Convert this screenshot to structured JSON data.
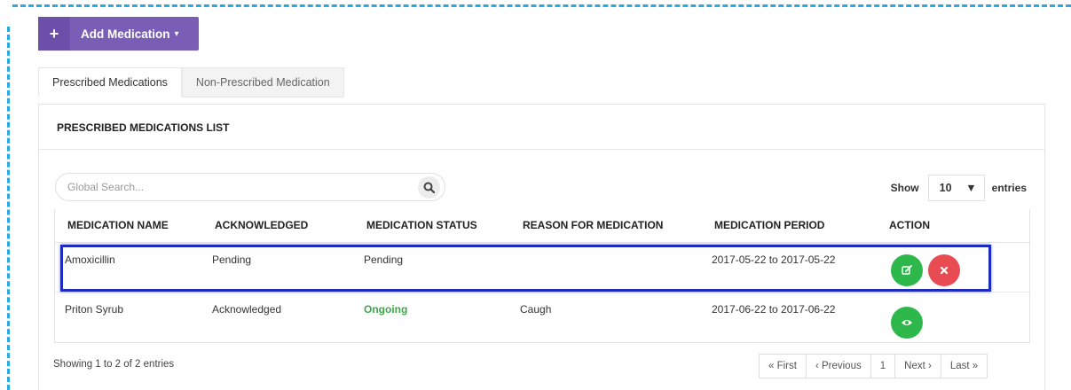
{
  "toolbar": {
    "add_label": "Add Medication",
    "plus_glyph": "+",
    "caret_glyph": "▾"
  },
  "tabs": [
    {
      "label": "Prescribed Medications",
      "active": true
    },
    {
      "label": "Non-Prescribed Medication",
      "active": false
    }
  ],
  "panel": {
    "title": "PRESCRIBED MEDICATIONS LIST"
  },
  "search": {
    "placeholder": "Global Search..."
  },
  "length": {
    "show_label": "Show",
    "value": "10",
    "entries_label": "entries"
  },
  "table": {
    "headers": [
      "MEDICATION NAME",
      "ACKNOWLEDGED",
      "MEDICATION STATUS",
      "REASON FOR MEDICATION",
      "MEDICATION PERIOD",
      "ACTION"
    ],
    "rows": [
      {
        "name": "Amoxicillin",
        "acknowledged": "Pending",
        "status": "Pending",
        "reason": "",
        "period": "2017-05-22 to 2017-05-22",
        "actions": [
          "edit-icon",
          "delete-icon"
        ]
      },
      {
        "name": "Priton Syrub",
        "acknowledged": "Acknowledged",
        "status": "Ongoing",
        "reason": "Caugh",
        "period": "2017-06-22 to 2017-06-22",
        "actions": [
          "view-icon"
        ]
      }
    ]
  },
  "footer": {
    "info": "Showing 1 to 2 of 2 entries",
    "pager": {
      "first": "« First",
      "previous": "‹ Previous",
      "page": "1",
      "next": "Next ›",
      "last": "Last »"
    }
  },
  "colors": {
    "accent": "#7a5eb5",
    "success": "#2eb84c",
    "danger": "#e84b52",
    "highlight": "#1f2bbd",
    "dashed_border": "#29a9e1"
  }
}
